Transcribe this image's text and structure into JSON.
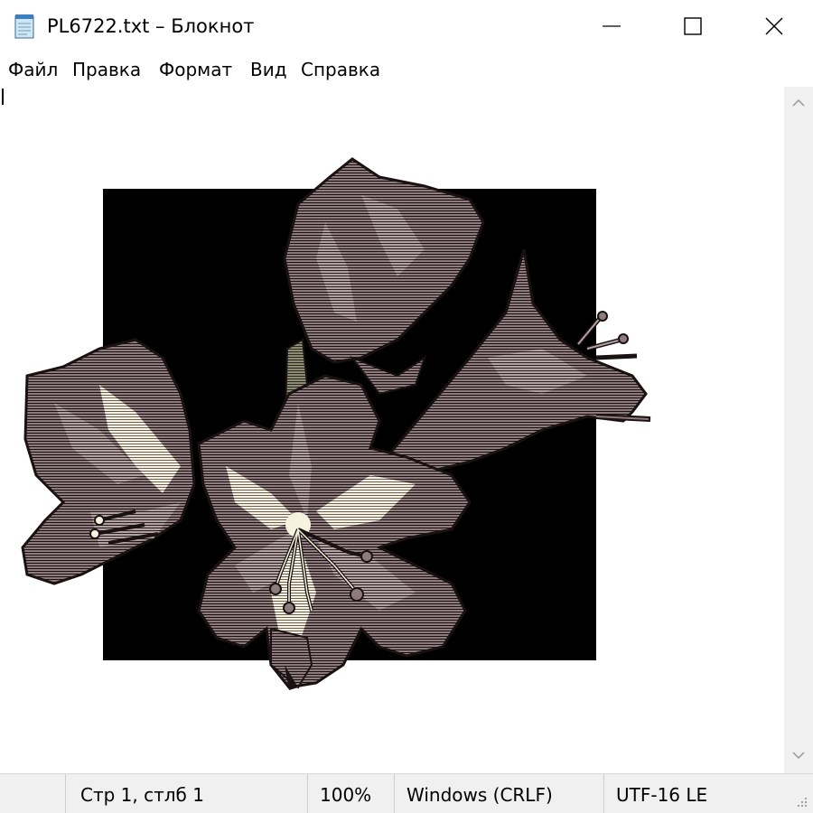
{
  "window": {
    "title": "PL6722.txt – Блокнот",
    "controls": {
      "minimize": "—",
      "maximize": "☐",
      "close": "✕"
    },
    "icon": "notepad-icon"
  },
  "menu": {
    "items": [
      {
        "label": "Файл"
      },
      {
        "label": "Правка"
      },
      {
        "label": "Формат"
      },
      {
        "label": "Вид"
      },
      {
        "label": "Справка"
      }
    ]
  },
  "editor": {
    "content_description_icon": "flower-ascii-art-icon",
    "colors": {
      "background_square": "#000000",
      "petal": "#8d7b7e",
      "petal_light": "#b3a2a4",
      "petal_highlight": "#f6f2df",
      "stem": "#8e8c74",
      "outline": "#1a1212"
    }
  },
  "status": {
    "position": "Стр 1, стлб 1",
    "zoom": "100%",
    "line_endings": "Windows (CRLF)",
    "encoding": "UTF-16 LE"
  },
  "colors": {
    "window_bg": "#ffffff",
    "statusbar_bg": "#f0f0f0",
    "scrollbar_bg": "#f0f0f0"
  }
}
